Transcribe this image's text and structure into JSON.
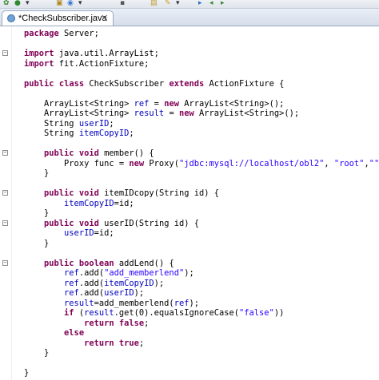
{
  "tab": {
    "title": "*CheckSubscriber.java",
    "close_glyph": "✕"
  },
  "code_lines": [
    [
      {
        "t": "package",
        "c": "kw"
      },
      {
        "t": " Server;"
      }
    ],
    [],
    [
      {
        "t": "import",
        "c": "kw"
      },
      {
        "t": " java.util.ArrayList;"
      }
    ],
    [
      {
        "t": "import",
        "c": "kw"
      },
      {
        "t": " fit.ActionFixture;"
      }
    ],
    [],
    [
      {
        "t": "public",
        "c": "kw"
      },
      {
        "t": " "
      },
      {
        "t": "class",
        "c": "kw"
      },
      {
        "t": " CheckSubscriber "
      },
      {
        "t": "extends",
        "c": "kw"
      },
      {
        "t": " ActionFixture {"
      }
    ],
    [],
    [
      {
        "t": "    ArrayList<String> "
      },
      {
        "t": "ref",
        "c": "fld"
      },
      {
        "t": " = "
      },
      {
        "t": "new",
        "c": "kw"
      },
      {
        "t": " ArrayList<String>();"
      }
    ],
    [
      {
        "t": "    ArrayList<String> "
      },
      {
        "t": "result",
        "c": "fld"
      },
      {
        "t": " = "
      },
      {
        "t": "new",
        "c": "kw"
      },
      {
        "t": " ArrayList<String>();"
      }
    ],
    [
      {
        "t": "    String "
      },
      {
        "t": "userID",
        "c": "fld"
      },
      {
        "t": ";"
      }
    ],
    [
      {
        "t": "    String "
      },
      {
        "t": "itemCopyID",
        "c": "fld"
      },
      {
        "t": ";"
      }
    ],
    [],
    [
      {
        "t": "    "
      },
      {
        "t": "public",
        "c": "kw"
      },
      {
        "t": " "
      },
      {
        "t": "void",
        "c": "kw"
      },
      {
        "t": " member() {"
      }
    ],
    [
      {
        "t": "        Proxy func = "
      },
      {
        "t": "new",
        "c": "kw"
      },
      {
        "t": " Proxy("
      },
      {
        "t": "\"jdbc:mysql://localhost/obl2\"",
        "c": "str"
      },
      {
        "t": ", "
      },
      {
        "t": "\"root\"",
        "c": "str"
      },
      {
        "t": ","
      },
      {
        "t": "\"\"",
        "c": "str"
      },
      {
        "t": ")"
      }
    ],
    [
      {
        "t": "    }"
      }
    ],
    [],
    [
      {
        "t": "    "
      },
      {
        "t": "public",
        "c": "kw"
      },
      {
        "t": " "
      },
      {
        "t": "void",
        "c": "kw"
      },
      {
        "t": " itemIDcopy(String id) {"
      }
    ],
    [
      {
        "t": "        "
      },
      {
        "t": "itemCopyID",
        "c": "fld"
      },
      {
        "t": "=id;"
      }
    ],
    [
      {
        "t": "    }"
      }
    ],
    [
      {
        "t": "    "
      },
      {
        "t": "public",
        "c": "kw"
      },
      {
        "t": " "
      },
      {
        "t": "void",
        "c": "kw"
      },
      {
        "t": " userID(String id) {"
      }
    ],
    [
      {
        "t": "        "
      },
      {
        "t": "userID",
        "c": "fld"
      },
      {
        "t": "=id;"
      }
    ],
    [
      {
        "t": "    }"
      }
    ],
    [],
    [
      {
        "t": "    "
      },
      {
        "t": "public",
        "c": "kw"
      },
      {
        "t": " "
      },
      {
        "t": "boolean",
        "c": "kw"
      },
      {
        "t": " addLend() {"
      }
    ],
    [
      {
        "t": "        "
      },
      {
        "t": "ref",
        "c": "fld"
      },
      {
        "t": ".add("
      },
      {
        "t": "\"add_memberlend\"",
        "c": "str"
      },
      {
        "t": ");"
      }
    ],
    [
      {
        "t": "        "
      },
      {
        "t": "ref",
        "c": "fld"
      },
      {
        "t": ".add("
      },
      {
        "t": "itemCopyID",
        "c": "fld"
      },
      {
        "t": ");"
      }
    ],
    [
      {
        "t": "        "
      },
      {
        "t": "ref",
        "c": "fld"
      },
      {
        "t": ".add("
      },
      {
        "t": "userID",
        "c": "fld"
      },
      {
        "t": ");"
      }
    ],
    [
      {
        "t": "        "
      },
      {
        "t": "result",
        "c": "fld"
      },
      {
        "t": "=add_memberlend("
      },
      {
        "t": "ref",
        "c": "fld"
      },
      {
        "t": ");"
      }
    ],
    [
      {
        "t": "        "
      },
      {
        "t": "if",
        "c": "kw"
      },
      {
        "t": " ("
      },
      {
        "t": "result",
        "c": "fld"
      },
      {
        "t": ".get(0).equalsIgnoreCase("
      },
      {
        "t": "\"false\"",
        "c": "str"
      },
      {
        "t": "))"
      }
    ],
    [
      {
        "t": "            "
      },
      {
        "t": "return",
        "c": "kw"
      },
      {
        "t": " "
      },
      {
        "t": "false",
        "c": "kw"
      },
      {
        "t": ";"
      }
    ],
    [
      {
        "t": "        "
      },
      {
        "t": "else",
        "c": "kw"
      }
    ],
    [
      {
        "t": "            "
      },
      {
        "t": "return",
        "c": "kw"
      },
      {
        "t": " "
      },
      {
        "t": "true",
        "c": "kw"
      },
      {
        "t": ";"
      }
    ],
    [
      {
        "t": "    }"
      }
    ],
    [],
    [
      {
        "t": "}"
      }
    ]
  ],
  "fold_markers": [
    {
      "line": 2,
      "glyph": "⊖"
    },
    {
      "line": 12,
      "glyph": "⊖"
    },
    {
      "line": 16,
      "glyph": "⊖"
    },
    {
      "line": 19,
      "glyph": "⊖"
    },
    {
      "line": 23,
      "glyph": "⊖"
    }
  ],
  "toolbar_icons": [
    {
      "name": "debug-icon",
      "glyph": "✿"
    },
    {
      "name": "run-icon",
      "glyph": "●"
    },
    {
      "name": "run-external-icon",
      "glyph": "▾"
    },
    {
      "name": "new-package-icon",
      "glyph": "▣"
    },
    {
      "name": "new-class-icon",
      "glyph": "◉"
    },
    {
      "name": "open-type-icon",
      "glyph": "▾"
    },
    {
      "name": "search-icon",
      "glyph": "▪"
    },
    {
      "name": "open-folder-icon",
      "glyph": "▤"
    },
    {
      "name": "marker-icon",
      "glyph": "✎"
    },
    {
      "name": "prev-annotation-icon",
      "glyph": "▾"
    },
    {
      "name": "next-annotation-icon",
      "glyph": "▸"
    },
    {
      "name": "back-icon",
      "glyph": "◂"
    },
    {
      "name": "forward-icon",
      "glyph": "▸"
    }
  ]
}
